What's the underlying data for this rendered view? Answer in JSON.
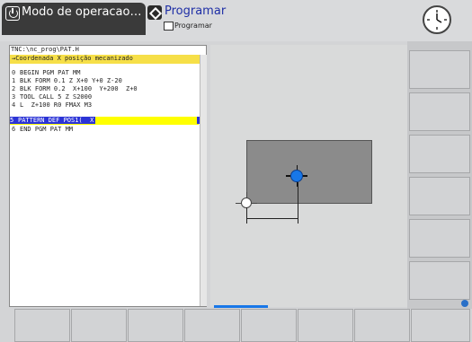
{
  "header": {
    "mode_label": "Modo de operacao…",
    "program_title": "Programar",
    "program_subtitle": "Programar"
  },
  "editor": {
    "file_path": "TNC:\\nc_prog\\PAT.H",
    "prompt": "→Coordenada X posição mecanizado",
    "lines": [
      {
        "num": "0",
        "text": "BEGIN PGM PAT MM"
      },
      {
        "num": "1",
        "text": "BLK FORM 0.1 Z X+0 Y+0 Z-20"
      },
      {
        "num": "2",
        "text": "BLK FORM 0.2  X+100  Y+200  Z+0"
      },
      {
        "num": "3",
        "text": "TOOL CALL 5 Z S2000"
      },
      {
        "num": "4",
        "text": "L  Z+100 R0 FMAX M3"
      },
      {
        "num": "5",
        "text": "PATTERN DEF POS1(  X"
      },
      {
        "num": "6",
        "text": "END PGM PAT MM"
      }
    ],
    "active_line": 5
  },
  "icons": {
    "power": "power-icon",
    "program": "program-edit-icon",
    "clock": "clock-icon",
    "info": "info-icon"
  },
  "colors": {
    "highlight_yellow": "#f6df48",
    "active_blue": "#2c34d6",
    "marker_blue": "#1877e8"
  }
}
